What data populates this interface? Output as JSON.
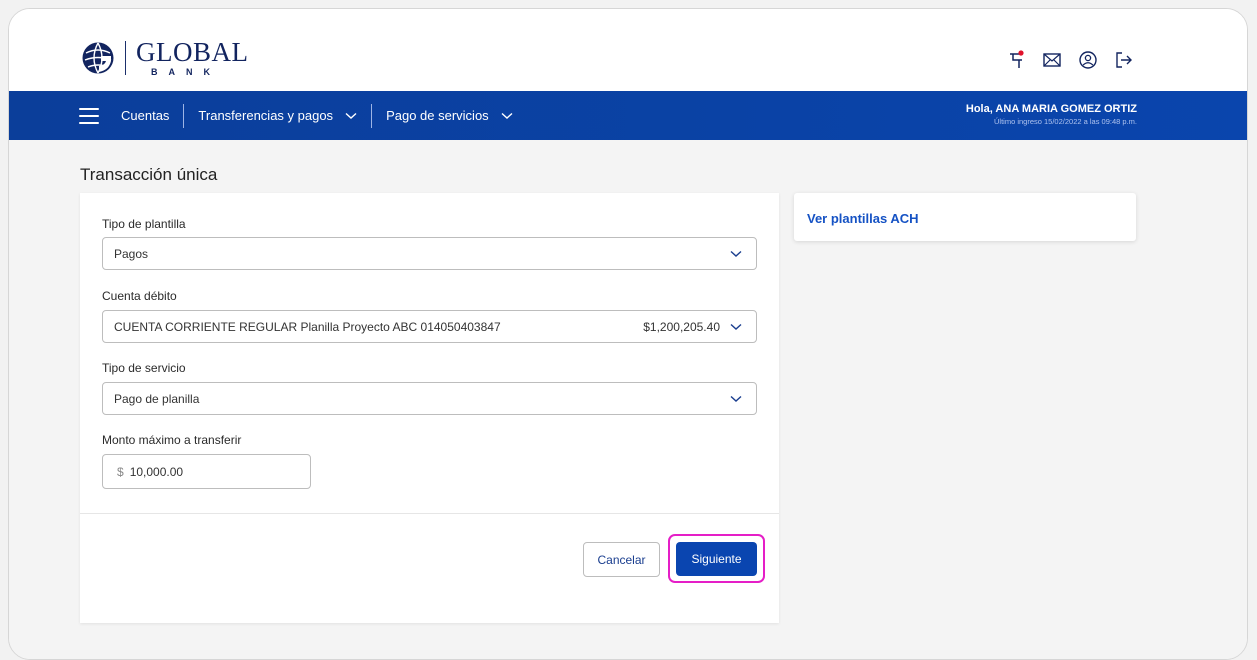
{
  "brand": {
    "name": "GLOBAL",
    "sub": "BANK"
  },
  "nav": {
    "items": [
      {
        "label": "Cuentas"
      },
      {
        "label": "Transferencias y pagos"
      },
      {
        "label": "Pago de servicios"
      }
    ],
    "greeting": "Hola, ANA MARIA GOMEZ ORTIZ",
    "last_login": "Último ingreso 15/02/2022 a las 09:48 p.m."
  },
  "icons": {
    "flag": "flag-icon",
    "mail": "mail-icon",
    "user": "user-icon",
    "logout": "logout-icon",
    "menu": "menu-icon"
  },
  "colors": {
    "nav_blue": "#0a45ad",
    "brand_navy": "#12245f",
    "highlight": "#e51ec7",
    "link": "#1552c4"
  },
  "page": {
    "title": "Transacción única"
  },
  "form": {
    "template_type": {
      "label": "Tipo de plantilla",
      "value": "Pagos"
    },
    "debit_account": {
      "label": "Cuenta débito",
      "value": "CUENTA CORRIENTE REGULAR Planilla Proyecto ABC 014050403847",
      "balance": "$1,200,205.40"
    },
    "service_type": {
      "label": "Tipo de servicio",
      "value": "Pago de planilla"
    },
    "max_amount": {
      "label": "Monto máximo a transferir",
      "currency": "$",
      "value": "10,000.00"
    },
    "cancel_label": "Cancelar",
    "next_label": "Siguiente"
  },
  "side": {
    "link": "Ver plantillas ACH"
  }
}
